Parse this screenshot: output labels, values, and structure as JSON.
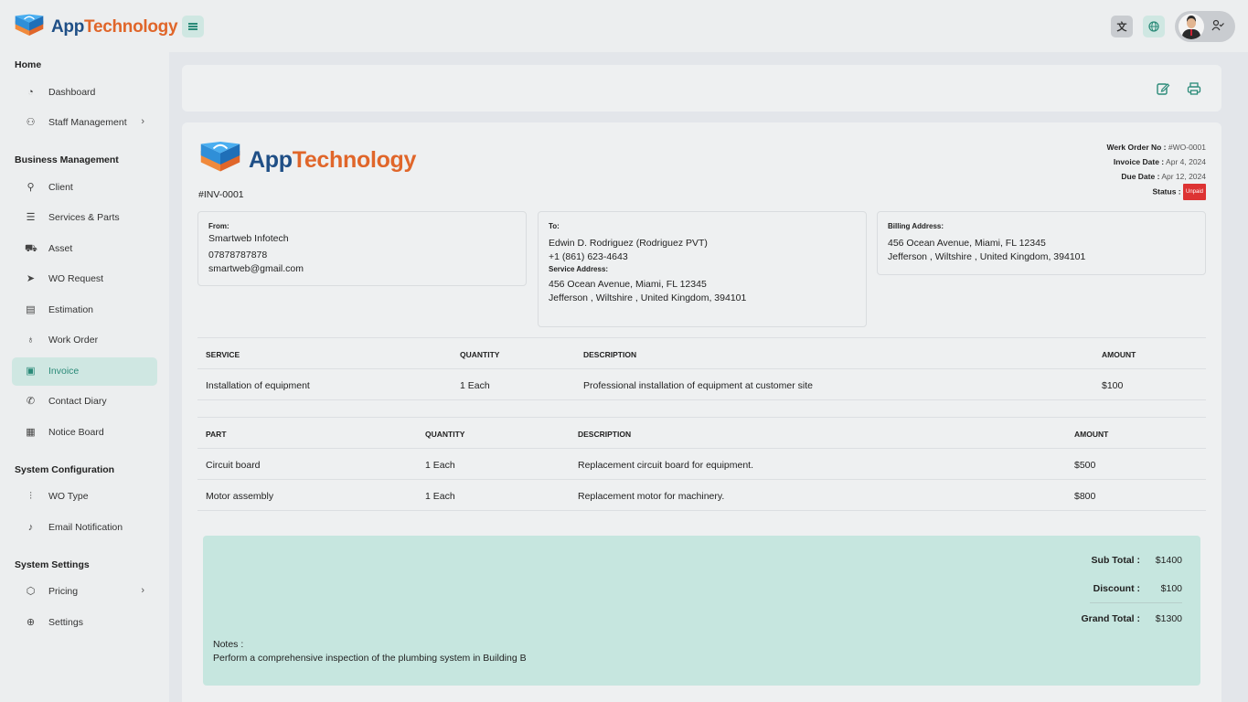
{
  "app": {
    "brand_part1": "App",
    "brand_part2": "Technology"
  },
  "colors": {
    "accent": "#2a8a78",
    "accent_light": "#cfe7e2",
    "brand_blue": "#1f4f86",
    "brand_orange": "#e0662a",
    "status_unpaid": "#dd3333"
  },
  "topbar": {
    "menu_icon": "hamburger-icon",
    "translate_icon": "translate-icon",
    "globe_icon": "globe-icon",
    "user_icon": "user-check-icon"
  },
  "sidebar": {
    "sections": [
      {
        "title": "Home",
        "items": [
          {
            "label": "Dashboard",
            "icon": "dashboard-icon"
          },
          {
            "label": "Staff Management",
            "icon": "users-icon",
            "has_submenu": true
          }
        ]
      },
      {
        "title": "Business Management",
        "items": [
          {
            "label": "Client",
            "icon": "client-icon"
          },
          {
            "label": "Services & Parts",
            "icon": "list-icon"
          },
          {
            "label": "Asset",
            "icon": "cart-icon"
          },
          {
            "label": "WO Request",
            "icon": "send-icon"
          },
          {
            "label": "Estimation",
            "icon": "document-icon"
          },
          {
            "label": "Work Order",
            "icon": "award-icon"
          },
          {
            "label": "Invoice",
            "icon": "invoice-icon",
            "active": true
          },
          {
            "label": "Contact Diary",
            "icon": "phone-icon"
          },
          {
            "label": "Notice Board",
            "icon": "board-icon"
          }
        ]
      },
      {
        "title": "System Configuration",
        "items": [
          {
            "label": "WO Type",
            "icon": "sliders-icon"
          },
          {
            "label": "Email Notification",
            "icon": "bell-icon"
          }
        ]
      },
      {
        "title": "System Settings",
        "items": [
          {
            "label": "Pricing",
            "icon": "box-icon",
            "has_submenu": true
          },
          {
            "label": "Settings",
            "icon": "settings-icon"
          }
        ]
      }
    ]
  },
  "toolbar": {
    "edit_icon": "edit-icon",
    "print_icon": "print-icon"
  },
  "invoice": {
    "number": "#INV-0001",
    "work_order_label": "Werk Order No :",
    "work_order_value": "#WO-0001",
    "invoice_date_label": "Invoice Date :",
    "invoice_date_value": "Apr 4, 2024",
    "due_date_label": "Due Date :",
    "due_date_value": "Apr 12, 2024",
    "status_label": "Status :",
    "status_value": "Unpaid",
    "from": {
      "label": "From:",
      "name": "Smartweb Infotech",
      "phone": "07878787878",
      "email": "smartweb@gmail.com"
    },
    "to": {
      "label": "To:",
      "name": "Edwin D. Rodriguez (Rodriguez PVT)",
      "phone": "+1 (861) 623-4643",
      "service_label": "Service Address:",
      "service_line1": "456 Ocean Avenue, Miami, FL 12345",
      "service_line2": "Jefferson , Wiltshire , United Kingdom, 394101"
    },
    "billing": {
      "label": "Billing Address:",
      "line1": "456 Ocean Avenue, Miami, FL 12345",
      "line2": "Jefferson , Wiltshire , United Kingdom, 394101"
    },
    "services_table": {
      "headers": [
        "SERVICE",
        "QUANTITY",
        "DESCRIPTION",
        "AMOUNT"
      ],
      "rows": [
        [
          "Installation of equipment",
          "1 Each",
          "Professional installation of equipment at customer site",
          "$100"
        ]
      ]
    },
    "parts_table": {
      "headers": [
        "PART",
        "QUANTITY",
        "DESCRIPTION",
        "AMOUNT"
      ],
      "rows": [
        [
          "Circuit board",
          "1 Each",
          "Replacement circuit board for equipment.",
          "$500"
        ],
        [
          "Motor assembly",
          "1 Each",
          "Replacement motor for machinery.",
          "$800"
        ]
      ]
    },
    "totals": {
      "sub_total_label": "Sub Total :",
      "sub_total": "$1400",
      "discount_label": "Discount :",
      "discount": "$100",
      "grand_total_label": "Grand Total :",
      "grand_total": "$1300"
    },
    "notes_label": "Notes :",
    "notes_text": "Perform a comprehensive inspection of the plumbing system in Building B"
  }
}
